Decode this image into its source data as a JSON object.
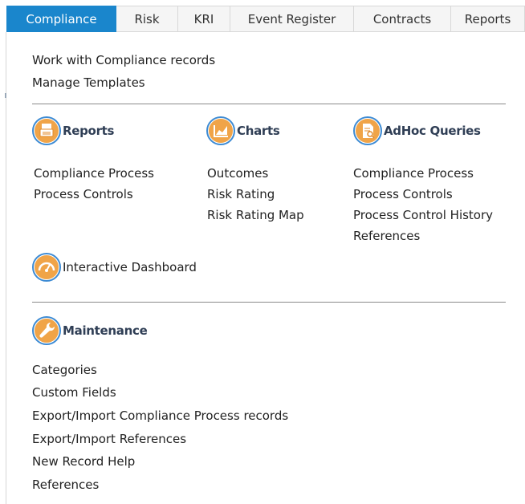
{
  "tabs": [
    {
      "label": "Compliance",
      "active": true
    },
    {
      "label": "Risk",
      "active": false
    },
    {
      "label": "KRI",
      "active": false
    },
    {
      "label": "Event Register",
      "active": false
    },
    {
      "label": "Contracts",
      "active": false
    },
    {
      "label": "Reports",
      "active": false
    }
  ],
  "top_links": [
    "Work with Compliance records",
    "Manage Templates"
  ],
  "reports": {
    "title": "Reports",
    "icon": "reports-icon",
    "items": [
      "Compliance Process",
      "Process Controls"
    ]
  },
  "charts": {
    "title": "Charts",
    "icon": "charts-icon",
    "items": [
      "Outcomes",
      "Risk Rating",
      "Risk Rating Map"
    ]
  },
  "adhoc": {
    "title": "AdHoc Queries",
    "icon": "adhoc-queries-icon",
    "items": [
      "Compliance Process",
      "Process Controls",
      "Process Control History",
      "References"
    ]
  },
  "dashboard": {
    "title": "Interactive Dashboard",
    "icon": "dashboard-gauge-icon"
  },
  "maintenance": {
    "title": "Maintenance",
    "icon": "wrench-icon",
    "items": [
      "Categories",
      "Custom Fields",
      "Export/Import Compliance Process records",
      "Export/Import References",
      "New Record Help",
      "References"
    ]
  },
  "colors": {
    "accent": "#1a86cc",
    "icon_orange": "#f0a448",
    "icon_ring": "#3d8bd4",
    "section_title": "#2f3e55"
  }
}
